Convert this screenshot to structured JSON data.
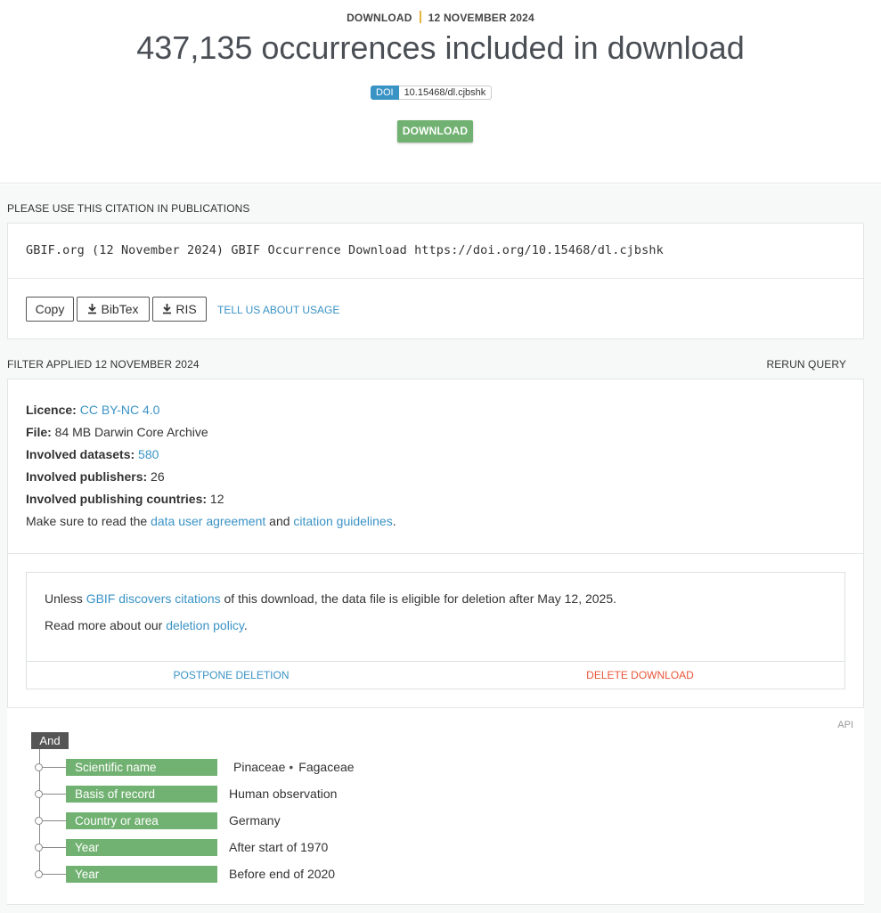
{
  "header": {
    "kind": "DOWNLOAD",
    "date": "12 NOVEMBER 2024",
    "title": "437,135 occurrences included in download",
    "doi_label": "DOI",
    "doi_value": "10.15468/dl.cjbshk",
    "download_label": "DOWNLOAD"
  },
  "citation": {
    "section_label": "PLEASE USE THIS CITATION IN PUBLICATIONS",
    "text": "GBIF.org (12 November 2024) GBIF Occurrence Download https://doi.org/10.15468/dl.cjbshk",
    "copy_label": "Copy",
    "bibtex_label": "BibTex",
    "ris_label": "RIS",
    "usage_label": "TELL US ABOUT USAGE"
  },
  "filter": {
    "section_label": "FILTER APPLIED 12 NOVEMBER 2024",
    "rerun_label": "RERUN QUERY",
    "licence_label": "Licence:",
    "licence_value": "CC BY-NC 4.0",
    "file_label": "File:",
    "file_value": "84 MB Darwin Core Archive",
    "datasets_label": "Involved datasets:",
    "datasets_value": "580",
    "publishers_label": "Involved publishers:",
    "publishers_value": "26",
    "countries_label": "Involved publishing countries:",
    "countries_value": "12",
    "agreement_prefix": "Make sure to read the",
    "agreement_link": "data user agreement",
    "agreement_and": "and",
    "guidelines_link": "citation guidelines",
    "agreement_suffix": "."
  },
  "deletion": {
    "line1_prefix": "Unless",
    "line1_link": "GBIF discovers citations",
    "line1_suffix": "of this download, the data file is eligible for deletion after May 12, 2025.",
    "line2_prefix": "Read more about our",
    "line2_link": "deletion policy",
    "line2_suffix": ".",
    "postpone_label": "POSTPONE DELETION",
    "delete_label": "DELETE DOWNLOAD"
  },
  "query": {
    "api_label": "API",
    "operator": "And",
    "filters": [
      {
        "label": "Scientific name",
        "values": [
          "Pinaceae",
          "Fagaceae"
        ]
      },
      {
        "label": "Basis of record",
        "value": "Human observation"
      },
      {
        "label": "Country or area",
        "value": "Germany"
      },
      {
        "label": "Year",
        "value": "After start of 1970"
      },
      {
        "label": "Year",
        "value": "Before end of 2020"
      }
    ]
  },
  "colors": {
    "accent": "#3a93c5",
    "green": "#71b171",
    "danger": "#e8563a",
    "date_separator": "#e4b43c"
  }
}
